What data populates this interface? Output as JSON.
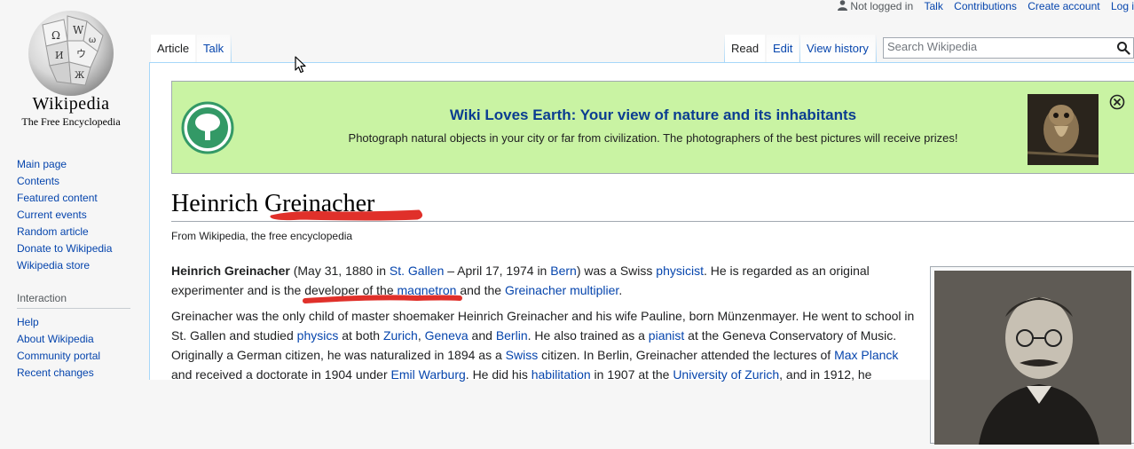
{
  "logo": {
    "wordmark": "Wikipedia",
    "tagline": "The Free Encyclopedia"
  },
  "personal_tools": {
    "not_logged_in": "Not logged in",
    "talk": "Talk",
    "contributions": "Contributions",
    "create_account": "Create account",
    "log_in": "Log i"
  },
  "sidebar": {
    "navigation": [
      "Main page",
      "Contents",
      "Featured content",
      "Current events",
      "Random article",
      "Donate to Wikipedia",
      "Wikipedia store"
    ],
    "interaction_heading": "Interaction",
    "interaction": [
      "Help",
      "About Wikipedia",
      "Community portal",
      "Recent changes"
    ]
  },
  "tabs": {
    "article": "Article",
    "talk": "Talk",
    "read": "Read",
    "edit": "Edit",
    "view_history": "View history"
  },
  "search": {
    "placeholder": "Search Wikipedia"
  },
  "banner": {
    "title": "Wiki Loves Earth: Your view of nature and its inhabitants",
    "text": "Photograph natural objects in your city or far from civilization. The photographers of the best pictures will receive prizes!"
  },
  "article": {
    "title": "Heinrich Greinacher",
    "site_sub": "From Wikipedia, the free encyclopedia",
    "p1": {
      "name": "Heinrich Greinacher",
      "t1": " (May 31, 1880 in ",
      "st_gallen": "St. Gallen",
      "t2": " – April 17, 1974 in ",
      "bern": "Bern",
      "t3": ") was a Swiss ",
      "physicist": "physicist",
      "t4": ". He is regarded as an original experimenter and is the developer of the ",
      "magnetron": "magnetron",
      "t5": " and the ",
      "multiplier": "Greinacher multiplier",
      "t6": "."
    },
    "p2": {
      "t1": "Greinacher was the only child of master shoemaker Heinrich Greinacher and his wife Pauline, born Münzenmayer. He went to school in St. Gallen and studied ",
      "physics": "physics",
      "t2": " at both ",
      "zurich": "Zurich",
      "c1": ", ",
      "geneva": "Geneva",
      "and1": " and ",
      "berlin": "Berlin",
      "t3": ". He also trained as a ",
      "pianist": "pianist",
      "t4": " at the Geneva Conservatory of Music. Originally a German citizen, he was naturalized in 1894 as a ",
      "swiss": "Swiss",
      "t5": " citizen. In Berlin, Greinacher attended the lectures of ",
      "planck": "Max Planck",
      "t6": " and received a doctorate in 1904 under ",
      "warburg": "Emil Warburg",
      "t7": ". He did his ",
      "habilitation": "habilitation",
      "t8": " in 1907 at the ",
      "uzh": "University of Zurich",
      "t9": ", and in 1912, he"
    }
  },
  "colors": {
    "link": "#0645ad",
    "banner_bg": "#c9f3a3",
    "banner_title": "#0b3d91",
    "annotation": "#e0302a"
  }
}
